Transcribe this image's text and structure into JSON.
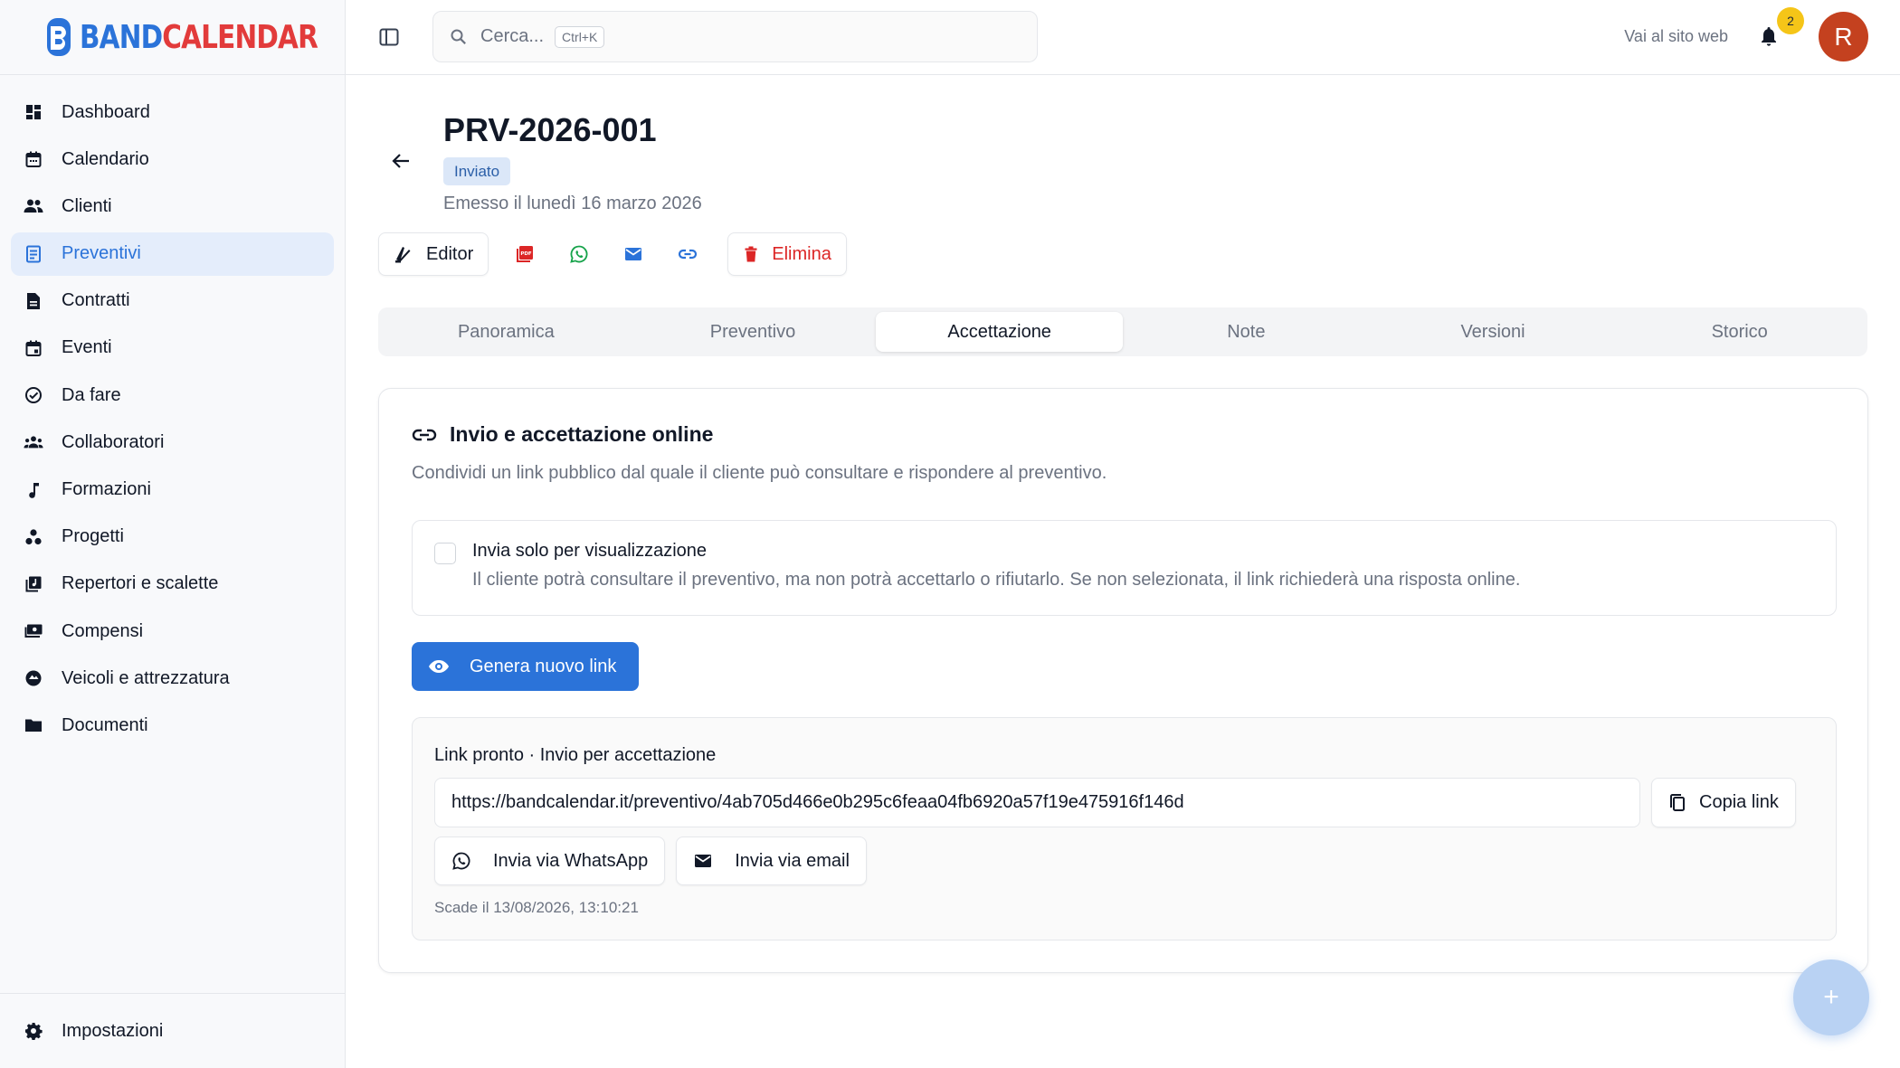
{
  "app": {
    "logo_part1": "BAND",
    "logo_part2": "CALENDAR",
    "brand_blue": "#2b73d9",
    "brand_red": "#e23b3b"
  },
  "sidebar": {
    "items": [
      {
        "label": "Dashboard",
        "icon": "dashboard-icon"
      },
      {
        "label": "Calendario",
        "icon": "calendar-icon"
      },
      {
        "label": "Clienti",
        "icon": "people-icon"
      },
      {
        "label": "Preventivi",
        "icon": "document-list-icon",
        "active": true
      },
      {
        "label": "Contratti",
        "icon": "file-icon"
      },
      {
        "label": "Eventi",
        "icon": "event-icon"
      },
      {
        "label": "Da fare",
        "icon": "check-circle-icon"
      },
      {
        "label": "Collaboratori",
        "icon": "group-icon"
      },
      {
        "label": "Formazioni",
        "icon": "music-note-icon"
      },
      {
        "label": "Progetti",
        "icon": "workspaces-icon"
      },
      {
        "label": "Repertori e scalette",
        "icon": "library-music-icon"
      },
      {
        "label": "Compensi",
        "icon": "payments-icon"
      },
      {
        "label": "Veicoli e attrezzatura",
        "icon": "vehicle-icon"
      },
      {
        "label": "Documenti",
        "icon": "folder-icon"
      }
    ],
    "footer_label": "Impostazioni"
  },
  "header": {
    "search_placeholder": "Cerca...",
    "search_shortcut": "Ctrl+K",
    "site_link": "Vai al sito web",
    "notification_count": "2",
    "avatar_initial": "R"
  },
  "quote": {
    "title": "PRV-2026-001",
    "status": "Inviato",
    "issued": "Emesso il lunedì 16 marzo 2026"
  },
  "actions": {
    "editor": "Editor",
    "delete": "Elimina"
  },
  "tabs": [
    "Panoramica",
    "Preventivo",
    "Accettazione",
    "Note",
    "Versioni",
    "Storico"
  ],
  "active_tab": "Accettazione",
  "card": {
    "title": "Invio e accettazione online",
    "subtitle": "Condividi un link pubblico dal quale il cliente può consultare e rispondere al preventivo.",
    "option_label": "Invia solo per visualizzazione",
    "option_desc": "Il cliente potrà consultare il preventivo, ma non potrà accettarlo o rifiutarlo. Se non selezionata, il link richiederà una risposta online.",
    "option_checked": false,
    "generate_btn": "Genera nuovo link",
    "link_header": "Link pronto · Invio per accettazione",
    "link_url": "https://bandcalendar.it/preventivo/4ab705d466e0b295c6feaa04fb6920a57f19e475916f146d",
    "copy_btn": "Copia link",
    "whatsapp_btn": "Invia via WhatsApp",
    "email_btn": "Invia via email",
    "expires": "Scade il 13/08/2026, 13:10:21"
  },
  "fab_label": "+"
}
